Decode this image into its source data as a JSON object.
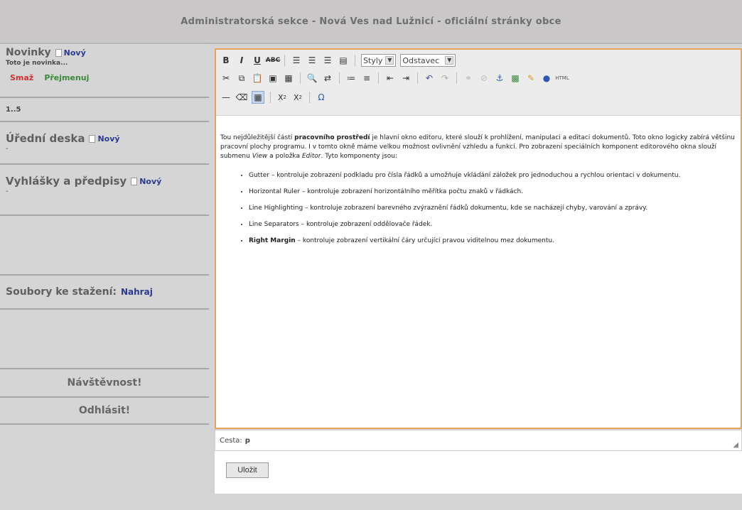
{
  "header": {
    "title": "Administratorská sekce - Nová Ves nad Lužnicí - oficiální stránky obce"
  },
  "sidebar": {
    "novinky": {
      "title": "Novinky",
      "new_label": "Nový",
      "item_text": "Toto je novinka...",
      "delete_label": "Smaž",
      "rename_label": "Přejmenuj",
      "pagination": "1..5"
    },
    "uredni_deska": {
      "title": "Úřední deska",
      "new_label": "Nový",
      "placeholder": "-"
    },
    "vyhlasky": {
      "title": "Vyhlášky a předpisy",
      "new_label": "Nový",
      "placeholder": "-"
    },
    "soubory": {
      "title": "Soubory ke stažení:",
      "upload_label": "Nahraj"
    },
    "navstevnost_label": "Návštěvnost!",
    "odhlasit_label": "Odhlásit!"
  },
  "editor": {
    "toolbar": {
      "style_select": "Styly",
      "format_select": "Odstavec"
    },
    "content": {
      "intro_prefix": "Tou nejdůležitější částí ",
      "intro_bold": "pracovního prostředí",
      "intro_rest": " je hlavní okno editoru, které slouží k prohlížení, manipulaci a editaci dokumentů. Toto okno logicky zabírá většinu pracovní plochy programu. I v tomto okně máme velkou možnost ovlivnění vzhledu a funkcí. Pro zobrazení speciálních komponent editorového okna slouží submenu ",
      "intro_view": "View",
      "intro_and": " a položka ",
      "intro_editor": "Editor",
      "intro_end": ". Tyto komponenty jsou:",
      "bullets": [
        "Gutter – kontroluje zobrazení podkladu pro čísla řádků a umožňuje vkládání záložek pro jednoduchou a rychlou orientaci v dokumentu.",
        "Horizontal Ruler – kontroluje zobrazení horizontálního měřítka počtu znaků v řádkách.",
        "Line Highlighting – kontroluje zobrazení barevného zvýraznění řádků dokumentu, kde se nacházejí chyby, varování a zprávy.",
        "Line Separators – kontroluje zobrazení oddělovače řádek."
      ],
      "last_bold": "Right Margin",
      "last_rest": " – kontroluje zobrazení vertikální čáry určující pravou viditelnou mez dokumentu."
    },
    "status": {
      "path_label": "Cesta:",
      "path_value": "p"
    },
    "save_label": "Uložit"
  },
  "colors": {
    "header_bg": "#c9c7c8",
    "sidebar_bg": "#d6d5d5",
    "editor_border": "#e7a35d",
    "link_blue": "#2a3a8f",
    "delete_red": "#cc3333",
    "rename_green": "#3a8a3a"
  }
}
